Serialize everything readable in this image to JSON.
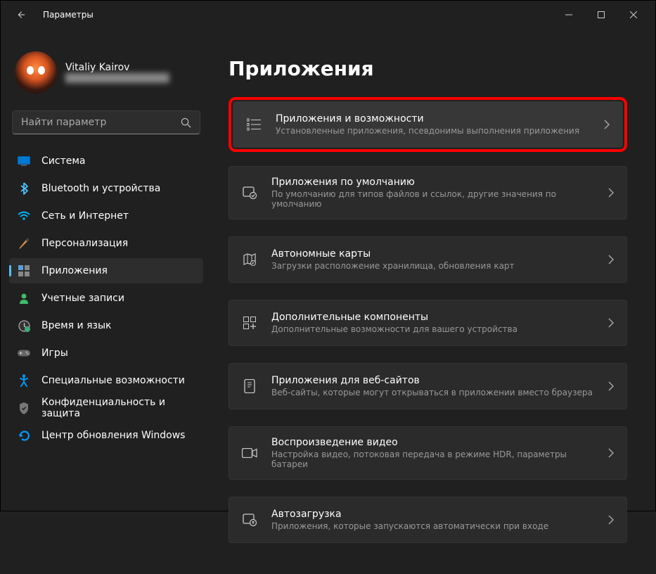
{
  "window": {
    "title": "Параметры"
  },
  "profile": {
    "name": "Vitaliy Kairov",
    "email": "████████████████"
  },
  "search": {
    "placeholder": "Найти параметр"
  },
  "sidebar": {
    "items": [
      {
        "label": "Система",
        "icon": "system",
        "color": "#0078d4"
      },
      {
        "label": "Bluetooth и устройства",
        "icon": "bluetooth",
        "color": "#0078d4"
      },
      {
        "label": "Сеть и Интернет",
        "icon": "wifi",
        "color": "#00b7ff"
      },
      {
        "label": "Персонализация",
        "icon": "brush",
        "color": "#d98e4a"
      },
      {
        "label": "Приложения",
        "icon": "apps",
        "color": "#888"
      },
      {
        "label": "Учетные записи",
        "icon": "account",
        "color": "#3fbd6a"
      },
      {
        "label": "Время и язык",
        "icon": "time",
        "color": "#555"
      },
      {
        "label": "Игры",
        "icon": "games",
        "color": "#888"
      },
      {
        "label": "Специальные возможности",
        "icon": "accessibility",
        "color": "#0099ff"
      },
      {
        "label": "Конфиденциальность и защита",
        "icon": "privacy",
        "color": "#888"
      },
      {
        "label": "Центр обновления Windows",
        "icon": "update",
        "color": "#0099ff"
      }
    ],
    "activeIndex": 4
  },
  "page": {
    "title": "Приложения",
    "cards": [
      {
        "title": "Приложения и возможности",
        "subtitle": "Установленные приложения, псевдонимы выполнения приложения",
        "icon": "list",
        "highlighted": true
      },
      {
        "title": "Приложения по умолчанию",
        "subtitle": "По умолчанию для типов файлов и ссылок, другие значения по умолчанию",
        "icon": "default-apps"
      },
      {
        "title": "Автономные карты",
        "subtitle": "Загрузки расположение хранилища, обновления карт",
        "icon": "maps"
      },
      {
        "title": "Дополнительные компоненты",
        "subtitle": "Дополнительные возможности для вашего устройства",
        "icon": "components"
      },
      {
        "title": "Приложения для веб-сайтов",
        "subtitle": "Веб-сайты, которые могут открываться в приложении вместо браузера",
        "icon": "web-apps"
      },
      {
        "title": "Воспроизведение видео",
        "subtitle": "Настройка видео, потоковая передача в режиме HDR, параметры батареи",
        "icon": "video"
      },
      {
        "title": "Автозагрузка",
        "subtitle": "Приложения, которые запускаются автоматически при входе",
        "icon": "startup"
      }
    ]
  }
}
